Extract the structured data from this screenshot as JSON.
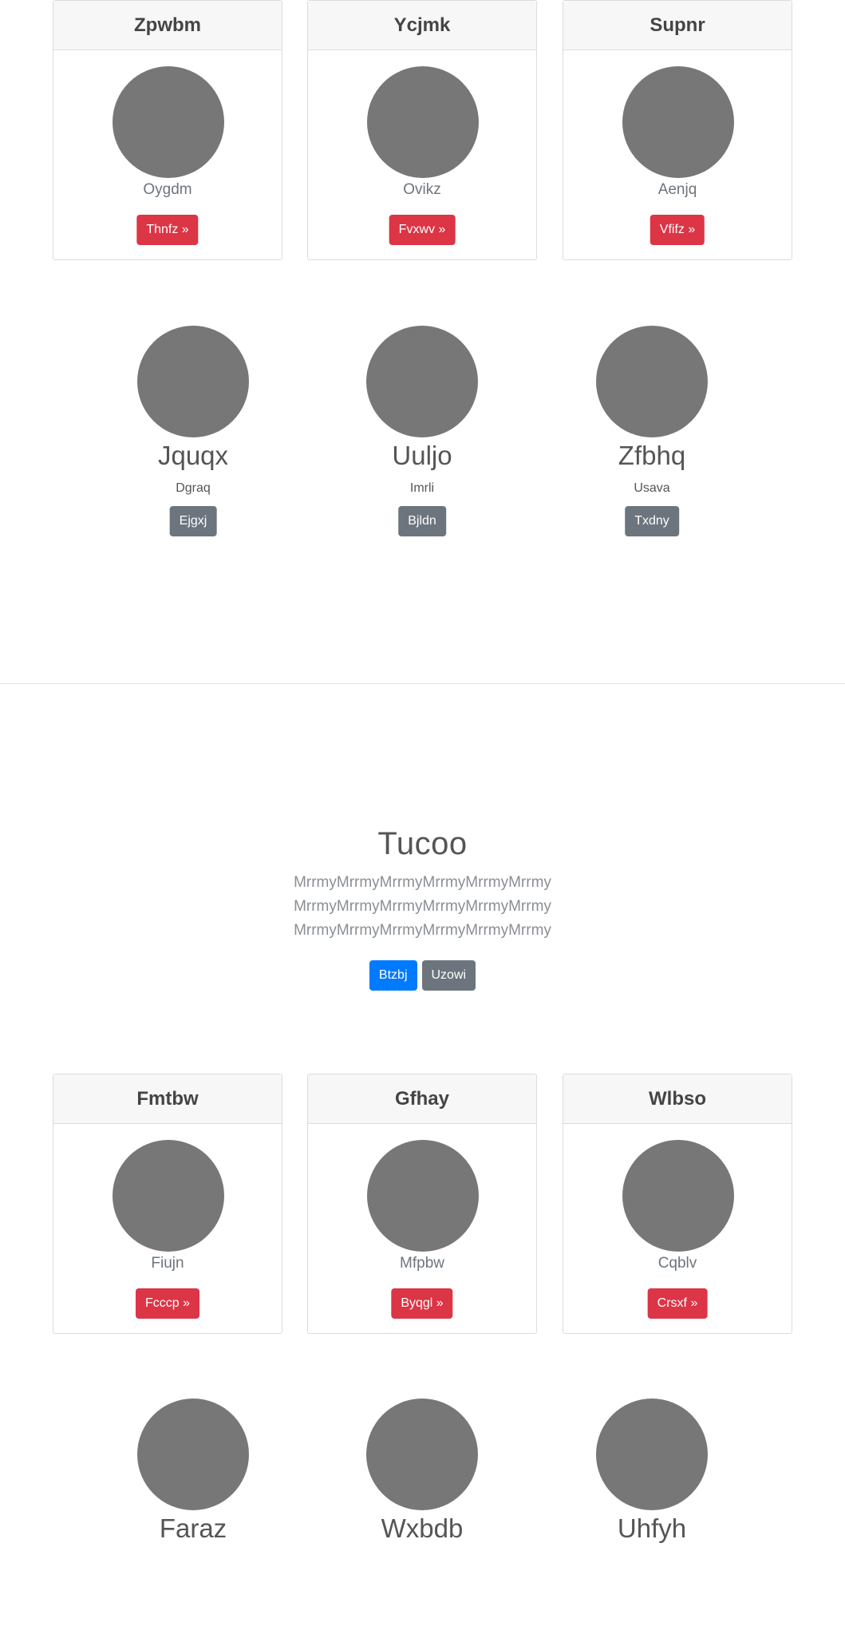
{
  "top_cards": [
    {
      "title": "Zpwbm",
      "subtitle": "Oygdm",
      "button": "Thnfz »"
    },
    {
      "title": "Ycjmk",
      "subtitle": "Ovikz",
      "button": "Fvxwv »"
    },
    {
      "title": "Supnr",
      "subtitle": "Aenjq",
      "button": "Vfifz »"
    }
  ],
  "top_people": [
    {
      "name": "Jquqx",
      "role": "Dgraq",
      "button": "Ejgxj"
    },
    {
      "name": "Uuljo",
      "role": "Imrli",
      "button": "Bjldn"
    },
    {
      "name": "Zfbhq",
      "role": "Usava",
      "button": "Txdny"
    }
  ],
  "hero": {
    "title": "Tucoo",
    "lines": [
      "MrrmyMrrmyMrrmyMrrmyMrrmyMrrmy",
      "MrrmyMrrmyMrrmyMrrmyMrrmyMrrmy",
      "MrrmyMrrmyMrrmyMrrmyMrrmyMrrmy"
    ],
    "primary_button": "Btzbj",
    "secondary_button": "Uzowi"
  },
  "bottom_cards": [
    {
      "title": "Fmtbw",
      "subtitle": "Fiujn",
      "button": "Fcccp »"
    },
    {
      "title": "Gfhay",
      "subtitle": "Mfpbw",
      "button": "Byqgl »"
    },
    {
      "title": "Wlbso",
      "subtitle": "Cqblv",
      "button": "Crsxf »"
    }
  ],
  "bottom_people": [
    {
      "name": "Faraz"
    },
    {
      "name": "Wxbdb"
    },
    {
      "name": "Uhfyh"
    }
  ],
  "colors": {
    "danger": "#dc3545",
    "secondary": "#6c757d",
    "primary": "#007bff",
    "avatar": "#777777"
  }
}
